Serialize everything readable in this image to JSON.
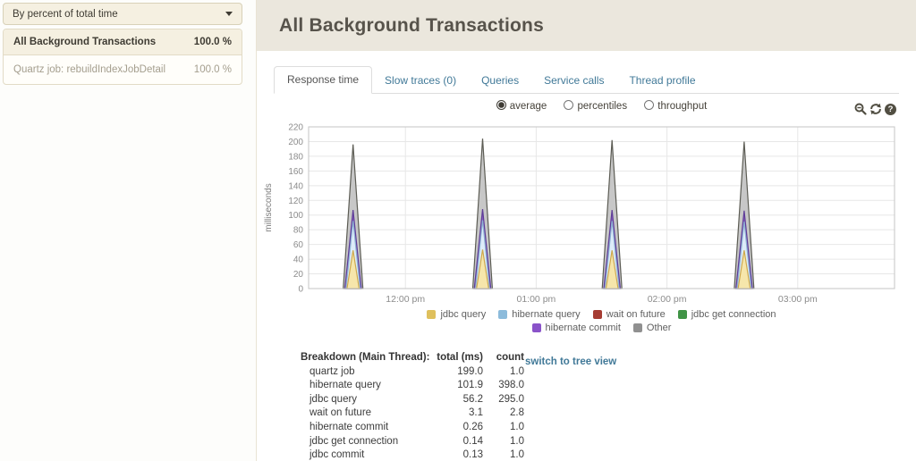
{
  "sidebar": {
    "filter_dropdown": {
      "label": "By percent of total time"
    },
    "items": [
      {
        "name": "All Background Transactions",
        "percent": "100.0 %",
        "active": true
      },
      {
        "name": "Quartz job: rebuildIndexJobDetail",
        "percent": "100.0 %",
        "active": false
      }
    ]
  },
  "header": {
    "title": "All Background Transactions"
  },
  "tabs": [
    {
      "label": "Response time",
      "active": true
    },
    {
      "label": "Slow traces (0)",
      "active": false
    },
    {
      "label": "Queries",
      "active": false
    },
    {
      "label": "Service calls",
      "active": false
    },
    {
      "label": "Thread profile",
      "active": false
    }
  ],
  "chart_controls": {
    "radios": [
      {
        "label": "average",
        "selected": true
      },
      {
        "label": "percentiles",
        "selected": false
      },
      {
        "label": "throughput",
        "selected": false
      }
    ],
    "icons": [
      "zoom-out",
      "refresh",
      "help"
    ]
  },
  "chart_data": {
    "type": "area",
    "title": "",
    "xlabel": "",
    "ylabel": "milliseconds",
    "ylim": [
      0,
      220
    ],
    "ytick_step": 20,
    "grid": true,
    "x_range_hours": [
      11.26,
      15.74
    ],
    "x_ticks": [
      {
        "hour": 12,
        "label": "12:00 pm"
      },
      {
        "hour": 13,
        "label": "01:00 pm"
      },
      {
        "hour": 14,
        "label": "02:00 pm"
      },
      {
        "hour": 15,
        "label": "03:00 pm"
      }
    ],
    "layers": [
      {
        "name": "Other",
        "fill": "#c7c7c7",
        "stroke": "#5c5c54",
        "half_width_factor": 1.0
      },
      {
        "name": "hibernate commit",
        "fill": "#8a5fc0",
        "stroke": "#5f3d99",
        "half_width_factor": 0.84
      },
      {
        "name": "hibernate query",
        "fill": "#ddecf9",
        "stroke": "#8fb4d4",
        "half_width_factor": 0.72
      },
      {
        "name": "jdbc query",
        "fill": "#f6e6ab",
        "stroke": "#cfa94d",
        "half_width_factor": 0.62
      }
    ],
    "spike_half_width_hours": 0.075,
    "spikes": [
      {
        "center_hour": 11.6,
        "values": [
          196,
          107,
          92,
          52
        ]
      },
      {
        "center_hour": 12.59,
        "values": [
          204,
          108,
          93,
          53
        ]
      },
      {
        "center_hour": 13.58,
        "values": [
          202,
          107,
          92,
          52
        ]
      },
      {
        "center_hour": 14.59,
        "values": [
          200,
          106,
          91,
          52
        ]
      }
    ],
    "legend_position": "bottom",
    "legend": [
      [
        {
          "label": "jdbc query",
          "color": "#dfc05d"
        },
        {
          "label": "hibernate query",
          "color": "#8cbbdb"
        },
        {
          "label": "wait on future",
          "color": "#a63c33"
        },
        {
          "label": "jdbc get connection",
          "color": "#409346"
        }
      ],
      [
        {
          "label": "hibernate commit",
          "color": "#8a53c9"
        },
        {
          "label": "Other",
          "color": "#909090"
        }
      ]
    ]
  },
  "breakdown": {
    "title": "Breakdown (Main Thread):",
    "columns": [
      "total (ms)",
      "count"
    ],
    "rows": [
      {
        "name": "quartz job",
        "total": "199.0",
        "count": "1.0"
      },
      {
        "name": "hibernate query",
        "total": "101.9",
        "count": "398.0"
      },
      {
        "name": "jdbc query",
        "total": "56.2",
        "count": "295.0"
      },
      {
        "name": "wait on future",
        "total": "3.1",
        "count": "2.8"
      },
      {
        "name": "hibernate commit",
        "total": "0.26",
        "count": "1.0"
      },
      {
        "name": "jdbc get connection",
        "total": "0.14",
        "count": "1.0"
      },
      {
        "name": "jdbc commit",
        "total": "0.13",
        "count": "1.0"
      }
    ],
    "switch_link": "switch to tree view"
  },
  "colors": {
    "accent_blue": "#417998",
    "header_bg": "#ebe7dd",
    "cream_bg": "#f5f0e1",
    "cream_border": "#d8d1b8",
    "muted_text": "#a49e8e",
    "icon": "#514e42",
    "grid": "#e7e7e7",
    "plot_border": "#c5c5c5",
    "tick_text": "#8c8c8c"
  }
}
